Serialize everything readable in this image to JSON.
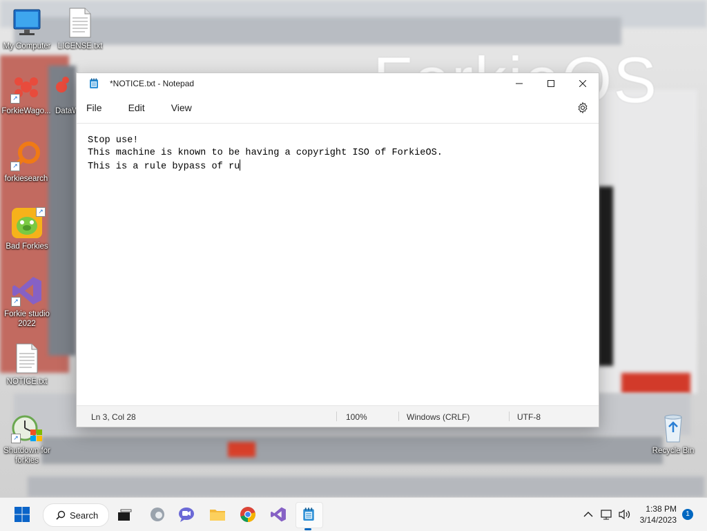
{
  "wallpaper": {
    "brand": "ForkieOS"
  },
  "desktop": {
    "icons": [
      {
        "label": "My Computer"
      },
      {
        "label": "LICENSE.txt"
      },
      {
        "label": "ForkieWago..."
      },
      {
        "label": "DataW"
      },
      {
        "label": "forkiesearch"
      },
      {
        "label": "Bad Forkies"
      },
      {
        "label": "Forkie studio 2022"
      },
      {
        "label": "NOTICE.txt"
      },
      {
        "label": "Shutdown for forkies"
      },
      {
        "label": "Recycle Bin"
      }
    ]
  },
  "notepad": {
    "title": "*NOTICE.txt - Notepad",
    "menu": [
      "File",
      "Edit",
      "View"
    ],
    "content": "Stop use!\nThis machine is known to be having a copyright ISO of ForkieOS.\nThis is a rule bypass of ru",
    "status": {
      "position": "Ln 3, Col 28",
      "zoom": "100%",
      "line_ending": "Windows (CRLF)",
      "encoding": "UTF-8"
    }
  },
  "taskbar": {
    "search_label": "Search",
    "time": "1:38 PM",
    "date": "3/14/2023",
    "notification_count": "1"
  }
}
